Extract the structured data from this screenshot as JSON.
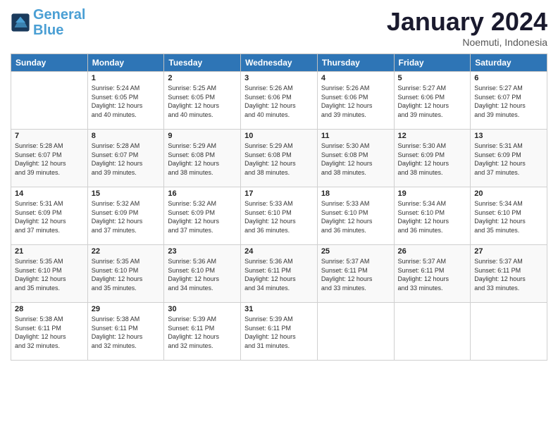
{
  "logo": {
    "text_general": "General",
    "text_blue": "Blue"
  },
  "header": {
    "month": "January 2024",
    "location": "Noemuti, Indonesia"
  },
  "columns": [
    "Sunday",
    "Monday",
    "Tuesday",
    "Wednesday",
    "Thursday",
    "Friday",
    "Saturday"
  ],
  "weeks": [
    [
      {
        "day": "",
        "info": ""
      },
      {
        "day": "1",
        "info": "Sunrise: 5:24 AM\nSunset: 6:05 PM\nDaylight: 12 hours\nand 40 minutes."
      },
      {
        "day": "2",
        "info": "Sunrise: 5:25 AM\nSunset: 6:05 PM\nDaylight: 12 hours\nand 40 minutes."
      },
      {
        "day": "3",
        "info": "Sunrise: 5:26 AM\nSunset: 6:06 PM\nDaylight: 12 hours\nand 40 minutes."
      },
      {
        "day": "4",
        "info": "Sunrise: 5:26 AM\nSunset: 6:06 PM\nDaylight: 12 hours\nand 39 minutes."
      },
      {
        "day": "5",
        "info": "Sunrise: 5:27 AM\nSunset: 6:06 PM\nDaylight: 12 hours\nand 39 minutes."
      },
      {
        "day": "6",
        "info": "Sunrise: 5:27 AM\nSunset: 6:07 PM\nDaylight: 12 hours\nand 39 minutes."
      }
    ],
    [
      {
        "day": "7",
        "info": "Sunrise: 5:28 AM\nSunset: 6:07 PM\nDaylight: 12 hours\nand 39 minutes."
      },
      {
        "day": "8",
        "info": "Sunrise: 5:28 AM\nSunset: 6:07 PM\nDaylight: 12 hours\nand 39 minutes."
      },
      {
        "day": "9",
        "info": "Sunrise: 5:29 AM\nSunset: 6:08 PM\nDaylight: 12 hours\nand 38 minutes."
      },
      {
        "day": "10",
        "info": "Sunrise: 5:29 AM\nSunset: 6:08 PM\nDaylight: 12 hours\nand 38 minutes."
      },
      {
        "day": "11",
        "info": "Sunrise: 5:30 AM\nSunset: 6:08 PM\nDaylight: 12 hours\nand 38 minutes."
      },
      {
        "day": "12",
        "info": "Sunrise: 5:30 AM\nSunset: 6:09 PM\nDaylight: 12 hours\nand 38 minutes."
      },
      {
        "day": "13",
        "info": "Sunrise: 5:31 AM\nSunset: 6:09 PM\nDaylight: 12 hours\nand 37 minutes."
      }
    ],
    [
      {
        "day": "14",
        "info": "Sunrise: 5:31 AM\nSunset: 6:09 PM\nDaylight: 12 hours\nand 37 minutes."
      },
      {
        "day": "15",
        "info": "Sunrise: 5:32 AM\nSunset: 6:09 PM\nDaylight: 12 hours\nand 37 minutes."
      },
      {
        "day": "16",
        "info": "Sunrise: 5:32 AM\nSunset: 6:09 PM\nDaylight: 12 hours\nand 37 minutes."
      },
      {
        "day": "17",
        "info": "Sunrise: 5:33 AM\nSunset: 6:10 PM\nDaylight: 12 hours\nand 36 minutes."
      },
      {
        "day": "18",
        "info": "Sunrise: 5:33 AM\nSunset: 6:10 PM\nDaylight: 12 hours\nand 36 minutes."
      },
      {
        "day": "19",
        "info": "Sunrise: 5:34 AM\nSunset: 6:10 PM\nDaylight: 12 hours\nand 36 minutes."
      },
      {
        "day": "20",
        "info": "Sunrise: 5:34 AM\nSunset: 6:10 PM\nDaylight: 12 hours\nand 35 minutes."
      }
    ],
    [
      {
        "day": "21",
        "info": "Sunrise: 5:35 AM\nSunset: 6:10 PM\nDaylight: 12 hours\nand 35 minutes."
      },
      {
        "day": "22",
        "info": "Sunrise: 5:35 AM\nSunset: 6:10 PM\nDaylight: 12 hours\nand 35 minutes."
      },
      {
        "day": "23",
        "info": "Sunrise: 5:36 AM\nSunset: 6:10 PM\nDaylight: 12 hours\nand 34 minutes."
      },
      {
        "day": "24",
        "info": "Sunrise: 5:36 AM\nSunset: 6:11 PM\nDaylight: 12 hours\nand 34 minutes."
      },
      {
        "day": "25",
        "info": "Sunrise: 5:37 AM\nSunset: 6:11 PM\nDaylight: 12 hours\nand 33 minutes."
      },
      {
        "day": "26",
        "info": "Sunrise: 5:37 AM\nSunset: 6:11 PM\nDaylight: 12 hours\nand 33 minutes."
      },
      {
        "day": "27",
        "info": "Sunrise: 5:37 AM\nSunset: 6:11 PM\nDaylight: 12 hours\nand 33 minutes."
      }
    ],
    [
      {
        "day": "28",
        "info": "Sunrise: 5:38 AM\nSunset: 6:11 PM\nDaylight: 12 hours\nand 32 minutes."
      },
      {
        "day": "29",
        "info": "Sunrise: 5:38 AM\nSunset: 6:11 PM\nDaylight: 12 hours\nand 32 minutes."
      },
      {
        "day": "30",
        "info": "Sunrise: 5:39 AM\nSunset: 6:11 PM\nDaylight: 12 hours\nand 32 minutes."
      },
      {
        "day": "31",
        "info": "Sunrise: 5:39 AM\nSunset: 6:11 PM\nDaylight: 12 hours\nand 31 minutes."
      },
      {
        "day": "",
        "info": ""
      },
      {
        "day": "",
        "info": ""
      },
      {
        "day": "",
        "info": ""
      }
    ]
  ]
}
